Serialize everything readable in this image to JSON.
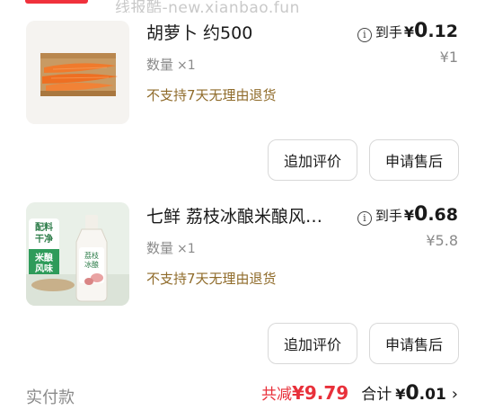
{
  "watermark": "线报酷-new.xianbao.fun",
  "items": [
    {
      "title": "胡萝卜 约500",
      "qty_label": "数量",
      "qty_count": "×1",
      "policy": "不支持7天无理由退货",
      "price_prefix": "到手",
      "price_symbol": "¥",
      "price_int": "0",
      "price_dec": ".12",
      "original_price": "¥1",
      "btn_review": "追加评价",
      "btn_after_sale": "申请售后",
      "thumb_icon": "carrot-image"
    },
    {
      "title": "七鲜 荔枝冰酿米酿风…",
      "qty_label": "数量",
      "qty_count": "×1",
      "policy": "不支持7天无理由退货",
      "price_prefix": "到手",
      "price_symbol": "¥",
      "price_int": "0",
      "price_dec": ".68",
      "original_price": "¥5.8",
      "btn_review": "追加评价",
      "btn_after_sale": "申请售后",
      "thumb_icon": "rice-wine-bottle-image",
      "thumb_texts": {
        "tag1": "配料",
        "tag2": "干净",
        "tag3": "米酿",
        "tag4": "风味",
        "bottle_line1": "荔枝",
        "bottle_line2": "冰酿"
      }
    }
  ],
  "footer": {
    "label": "实付款",
    "discount_label": "共减",
    "discount_value": "¥9.79",
    "total_label": "合计",
    "total_symbol": "¥",
    "total_int": "0",
    "total_dec": ".01",
    "chevron": "›"
  },
  "colors": {
    "accent_red": "#e8303a",
    "policy_brown": "#8f6b2a",
    "muted_gray": "#8a8a8a"
  }
}
